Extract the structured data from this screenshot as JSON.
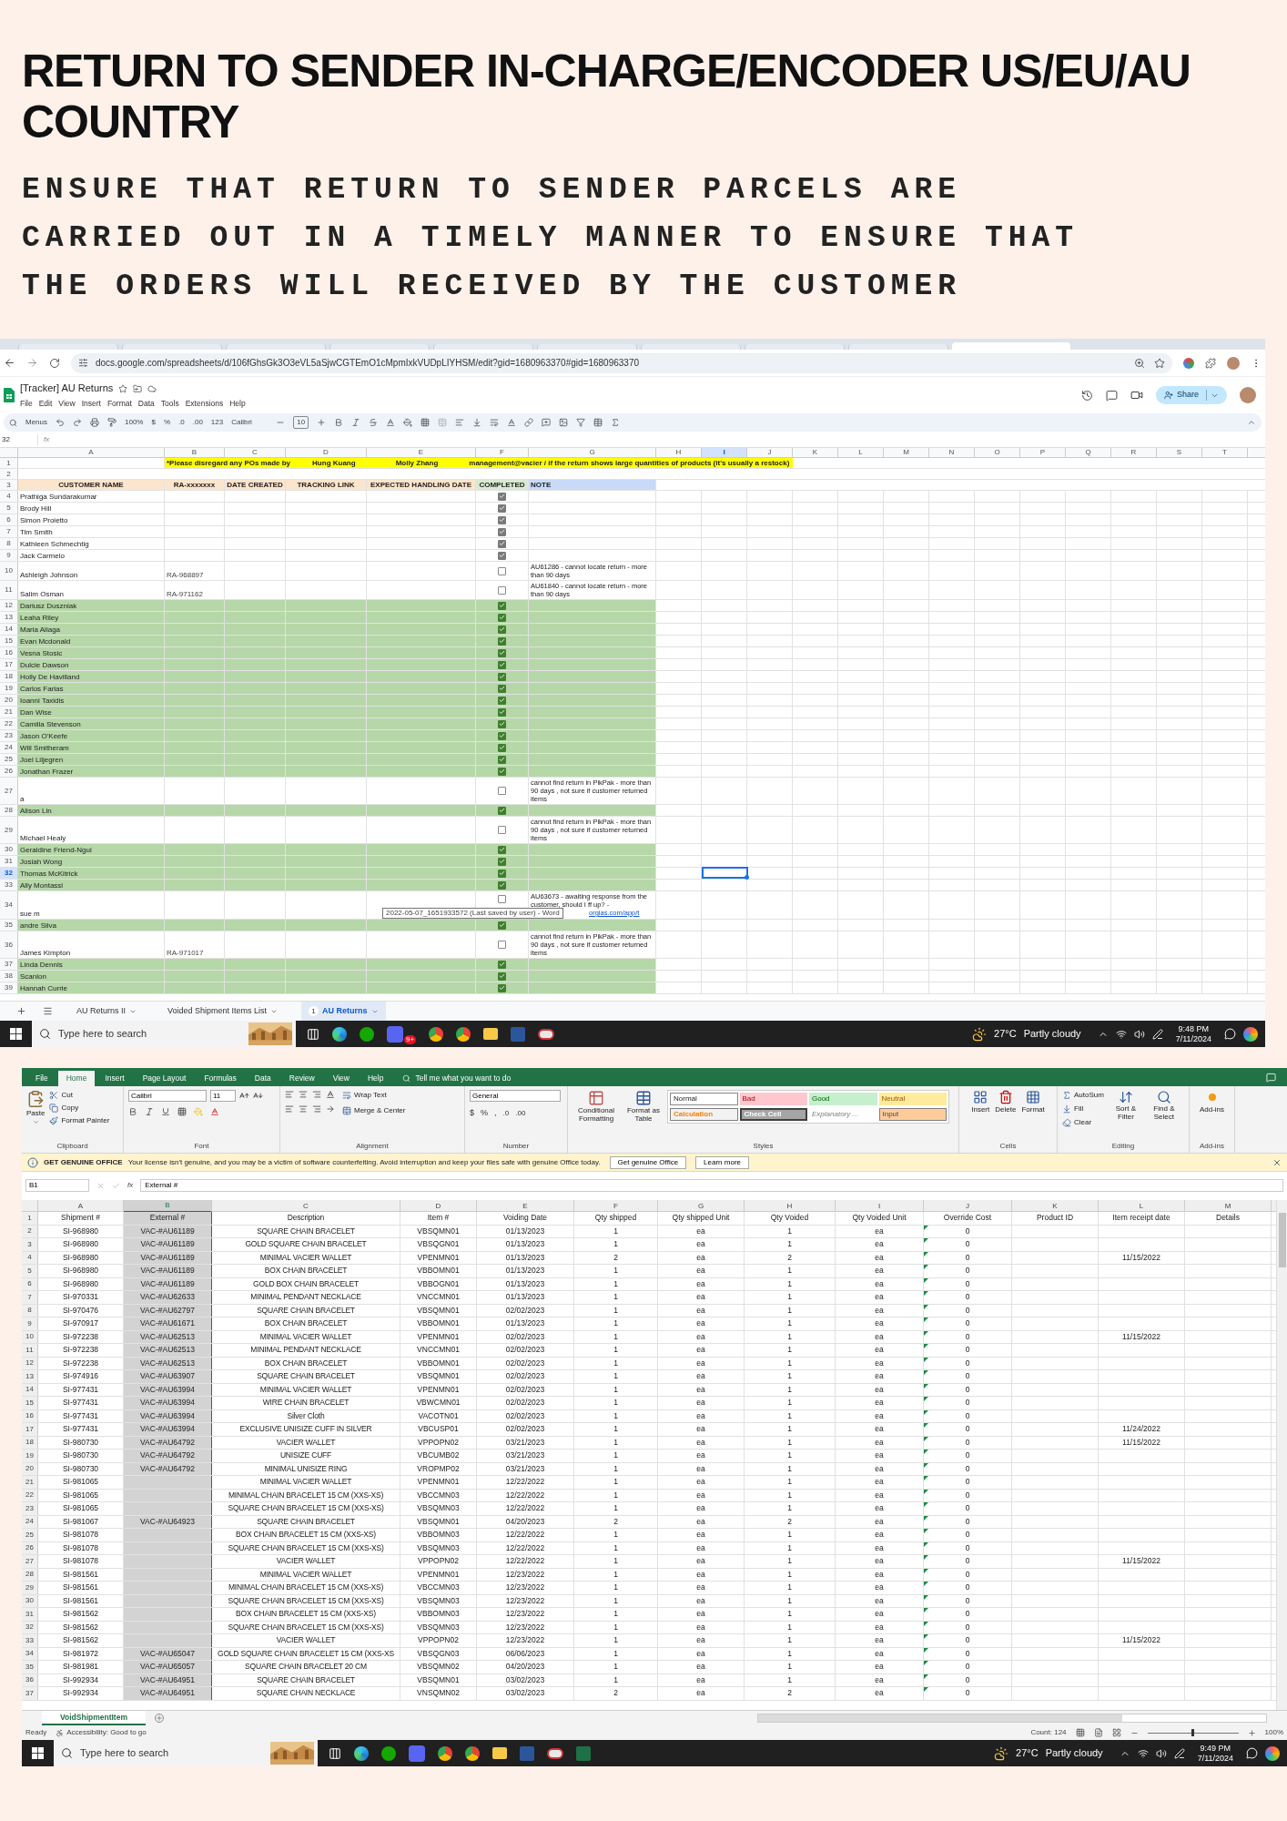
{
  "heading": {
    "title": "RETURN TO SENDER IN-CHARGE/ENCODER US/EU/AU COUNTRY",
    "subtitle": "ENSURE THAT RETURN TO SENDER PARCELS ARE CARRIED OUT IN A TIMELY MANNER TO ENSURE THAT THE ORDERS WILL RECEIVED BY THE CUSTOMER"
  },
  "sheets": {
    "url": "docs.google.com/spreadsheets/d/106fGhsGk3O3eVL5aSjwCGTEmO1cMpmIxkVUDpLIYHSM/edit?gid=1680963370#gid=1680963370",
    "title": "[Tracker] AU Returns",
    "menu": [
      "File",
      "Edit",
      "View",
      "Insert",
      "Format",
      "Data",
      "Tools",
      "Extensions",
      "Help"
    ],
    "share": "Share",
    "toolbar": {
      "menus": "Menus",
      "zoom": "100%",
      "currency": "$",
      "percent": "%",
      "decrease_decimal": ".0",
      "increase_decimal": ".00",
      "number_format": "123",
      "font": "Calibri",
      "font_size": "10"
    },
    "browser_tabs": [
      {
        "selected": false
      },
      {
        "selected": false
      },
      {
        "selected": false
      },
      {
        "selected": false
      },
      {
        "selected": false
      },
      {
        "selected": false
      },
      {
        "selected": false
      },
      {
        "selected": false
      },
      {
        "selected": false
      },
      {
        "selected": true
      }
    ],
    "name_box": "32",
    "formula_icon": "fx",
    "columns": [
      {
        "letter": "A",
        "selected": false
      },
      {
        "letter": "B",
        "selected": false
      },
      {
        "letter": "C",
        "selected": false
      },
      {
        "letter": "D",
        "selected": false
      },
      {
        "letter": "E",
        "selected": false
      },
      {
        "letter": "F",
        "selected": false
      },
      {
        "letter": "G",
        "selected": false
      },
      {
        "letter": "H",
        "selected": false
      },
      {
        "letter": "I",
        "selected": true
      },
      {
        "letter": "J",
        "selected": false
      },
      {
        "letter": "K",
        "selected": false
      },
      {
        "letter": "L",
        "selected": false
      },
      {
        "letter": "M",
        "selected": false
      },
      {
        "letter": "N",
        "selected": false
      },
      {
        "letter": "O",
        "selected": false
      },
      {
        "letter": "P",
        "selected": false
      },
      {
        "letter": "Q",
        "selected": false
      },
      {
        "letter": "R",
        "selected": false
      },
      {
        "letter": "S",
        "selected": false
      },
      {
        "letter": "T",
        "selected": false
      }
    ],
    "notice": [
      "*Please disregard any POs made by",
      "Hung Kuang",
      "Molly Zhang",
      "management@vacier / if the return shows large quantities of products (it's usually a restock)"
    ],
    "headers": [
      "CUSTOMER NAME",
      "RA-xxxxxxx",
      "DATE CREATED",
      "TRACKING LINK",
      "EXPECTED HANDLING DATE",
      "COMPLETED",
      "NOTE"
    ],
    "top_rows": [
      "1",
      "2",
      "3"
    ],
    "rows": [
      {
        "row": "4",
        "name": "Prathiga Sundarakumar",
        "completed": true,
        "highlighted": false,
        "active": false
      },
      {
        "row": "5",
        "name": "Brody Hill",
        "completed": true,
        "highlighted": false,
        "active": false
      },
      {
        "row": "6",
        "name": "Simon Proietto",
        "completed": true,
        "highlighted": false,
        "active": false
      },
      {
        "row": "7",
        "name": "Tim Smith",
        "completed": true,
        "highlighted": false,
        "active": false
      },
      {
        "row": "8",
        "name": "Kathleen Schmechtig",
        "completed": true,
        "highlighted": false,
        "active": false
      },
      {
        "row": "9",
        "name": "Jack Carmelo",
        "completed": true,
        "highlighted": false,
        "active": false
      },
      {
        "row": "10",
        "name": "Ashleigh Johnson",
        "ra": "RA-968897",
        "completed": false,
        "highlighted": false,
        "active": false,
        "note": "AU61286 - cannot locate return - more than 90 days"
      },
      {
        "row": "11",
        "name": "Salim Osman",
        "ra": "RA-971162",
        "completed": false,
        "highlighted": false,
        "active": false,
        "note": "AU61840 - cannot locate return - more than 90 days"
      },
      {
        "row": "12",
        "name": "Dariusz Duszniak",
        "completed": true,
        "highlighted": true,
        "active": false
      },
      {
        "row": "13",
        "name": "Leaha Riley",
        "completed": true,
        "highlighted": true,
        "active": false
      },
      {
        "row": "14",
        "name": "Maria Aliaga",
        "completed": true,
        "highlighted": true,
        "active": false
      },
      {
        "row": "15",
        "name": "Evan Mcdonald",
        "completed": true,
        "highlighted": true,
        "active": false
      },
      {
        "row": "16",
        "name": "Vesna Stosic",
        "completed": true,
        "highlighted": true,
        "active": false
      },
      {
        "row": "17",
        "name": "Dulcie Dawson",
        "completed": true,
        "highlighted": true,
        "active": false
      },
      {
        "row": "18",
        "name": "Holly De Havilland",
        "completed": true,
        "highlighted": true,
        "active": false
      },
      {
        "row": "19",
        "name": "Carlos Farias",
        "completed": true,
        "highlighted": true,
        "active": false
      },
      {
        "row": "20",
        "name": "Ioanni Taxidis",
        "completed": true,
        "highlighted": true,
        "active": false
      },
      {
        "row": "21",
        "name": "Dan Wise",
        "completed": true,
        "highlighted": true,
        "active": false
      },
      {
        "row": "22",
        "name": "Camilla Stevenson",
        "completed": true,
        "highlighted": true,
        "active": false
      },
      {
        "row": "23",
        "name": "Jason O'Keefe",
        "completed": true,
        "highlighted": true,
        "active": false
      },
      {
        "row": "24",
        "name": "Will Smitheram",
        "completed": true,
        "highlighted": true,
        "active": false
      },
      {
        "row": "25",
        "name": "Joel Liljegren",
        "completed": true,
        "highlighted": true,
        "active": false
      },
      {
        "row": "26",
        "name": "Jonathan Frazer",
        "completed": true,
        "highlighted": true,
        "active": false
      },
      {
        "row": "27",
        "name": "a",
        "completed": false,
        "highlighted": false,
        "active": false,
        "note": "cannot find return in PikPak - more than 90 days , not sure if customer returned items"
      },
      {
        "row": "28",
        "name": "Alison Lin",
        "completed": true,
        "highlighted": true,
        "active": false
      },
      {
        "row": "29",
        "name": "Michael Healy",
        "completed": false,
        "highlighted": false,
        "active": false,
        "note": "cannot find return in PikPak - more than 90 days , not sure if customer returned items"
      },
      {
        "row": "30",
        "name": "Geraldine Friend-Ngui",
        "completed": true,
        "highlighted": true,
        "active": false
      },
      {
        "row": "31",
        "name": "Josiah Wong",
        "completed": true,
        "highlighted": true,
        "active": false
      },
      {
        "row": "32",
        "name": "Thomas McKitrick",
        "completed": true,
        "highlighted": true,
        "active": true
      },
      {
        "row": "33",
        "name": "Ally Montassi",
        "completed": true,
        "highlighted": true,
        "active": false
      },
      {
        "row": "34",
        "name": "sue m",
        "completed": false,
        "highlighted": false,
        "active": false,
        "note": "AU63673 - awaiting response from the customer, should I ff up? -",
        "link": "orgias.com/app/t"
      },
      {
        "row": "35",
        "name": "andre Silva",
        "completed": true,
        "highlighted": true,
        "active": false
      },
      {
        "row": "36",
        "name": "James Kimpton",
        "ra": "RA-971017",
        "completed": false,
        "highlighted": false,
        "active": false,
        "note": "cannot find return in PikPak - more than 90 days , not sure if customer returned items"
      },
      {
        "row": "37",
        "name": "Linda Dennis",
        "completed": true,
        "highlighted": true,
        "active": false
      },
      {
        "row": "38",
        "name": "Scanlon",
        "completed": true,
        "highlighted": true,
        "active": false
      },
      {
        "row": "39",
        "name": "Hannah Currie",
        "completed": true,
        "highlighted": true,
        "active": false
      }
    ],
    "tooltip": "2022-05-07_1651933572 (Last saved by user) - Word",
    "sheet_tabs": [
      {
        "label": "AU Returns II",
        "selected": false
      },
      {
        "label": "Voided Shipment Items List",
        "selected": false
      },
      {
        "label": "AU Returns",
        "selected": true,
        "badge": "1"
      }
    ],
    "taskbar": {
      "search_placeholder": "Type here to search",
      "badge": "9+",
      "temperature": "27°C",
      "weather": "Partly cloudy",
      "time": "9:48 PM",
      "date": "7/11/2024"
    }
  },
  "excel": {
    "ribbon_tabs": [
      {
        "label": "File",
        "selected": false
      },
      {
        "label": "Home",
        "selected": true
      },
      {
        "label": "Insert",
        "selected": false
      },
      {
        "label": "Page Layout",
        "selected": false
      },
      {
        "label": "Formulas",
        "selected": false
      },
      {
        "label": "Data",
        "selected": false
      },
      {
        "label": "Review",
        "selected": false
      },
      {
        "label": "View",
        "selected": false
      },
      {
        "label": "Help",
        "selected": false
      }
    ],
    "tell_me": "Tell me what you want to do",
    "clipboard": {
      "paste": "Paste",
      "cut": "Cut",
      "copy": "Copy",
      "format_painter": "Format Painter"
    },
    "font": {
      "name": "Calibri",
      "size": "11"
    },
    "alignment": {
      "wrap_text": "Wrap Text",
      "merge": "Merge & Center"
    },
    "number": {
      "format": "General",
      "symbols": [
        "$",
        "%",
        ","
      ],
      "decimals": [
        ".0",
        ".00"
      ]
    },
    "styles": {
      "conditional": "Conditional Formatting",
      "format_table": "Format as Table",
      "gallery": [
        {
          "label": "Normal",
          "kind": "normal"
        },
        {
          "label": "Bad",
          "kind": "bad"
        },
        {
          "label": "Good",
          "kind": "good"
        },
        {
          "label": "Neutral",
          "kind": "neutral"
        },
        {
          "label": "Calculation",
          "kind": "calculation"
        },
        {
          "label": "Check Cell",
          "kind": "check"
        },
        {
          "label": "Explanatory ...",
          "kind": "explanatory"
        },
        {
          "label": "Input",
          "kind": "input"
        }
      ]
    },
    "cells": [
      "Insert",
      "Delete",
      "Format"
    ],
    "editing": {
      "autosum": "AutoSum",
      "fill": "Fill",
      "clear": "Clear",
      "sort": "Sort & Filter",
      "find": "Find & Select"
    },
    "addins": "Add-ins",
    "group_labels": [
      "Clipboard",
      "Font",
      "Alignment",
      "Number",
      "Styles",
      "Cells",
      "Editing",
      "Add-ins"
    ],
    "message": {
      "title": "GET GENUINE OFFICE",
      "text": "Your license isn't genuine, and you may be a victim of software counterfeiting. Avoid interruption and keep your files safe with genuine Office today.",
      "buttons": [
        "Get genuine Office",
        "Learn more"
      ]
    },
    "name_box": "B1",
    "formula_icon": "fx",
    "formula": "External #",
    "columns": [
      {
        "letter": "A",
        "selected": false
      },
      {
        "letter": "B",
        "selected": true
      },
      {
        "letter": "C",
        "selected": false
      },
      {
        "letter": "D",
        "selected": false
      },
      {
        "letter": "E",
        "selected": false
      },
      {
        "letter": "F",
        "selected": false
      },
      {
        "letter": "G",
        "selected": false
      },
      {
        "letter": "H",
        "selected": false
      },
      {
        "letter": "I",
        "selected": false
      },
      {
        "letter": "J",
        "selected": false
      },
      {
        "letter": "K",
        "selected": false
      },
      {
        "letter": "L",
        "selected": false
      },
      {
        "letter": "M",
        "selected": false
      }
    ],
    "override_cost_flagged": true,
    "rows": [
      {
        "row": "1",
        "A": "Shipment #",
        "B": "External #",
        "C": "Description",
        "D": "Item #",
        "E": "Voiding Date",
        "F": "Qty shipped",
        "G": "Qty shipped Unit",
        "H": "Qty Voided",
        "I": "Qty Voided Unit",
        "J": "Override Cost",
        "K": "Product ID",
        "L": "Item receipt date",
        "M": "Details"
      },
      {
        "row": "2",
        "A": "SI-968980",
        "B": "VAC-#AU61189",
        "C": "SQUARE CHAIN BRACELET",
        "D": "VBSQMN01",
        "E": "01/13/2023",
        "F": "1",
        "G": "ea",
        "H": "1",
        "I": "ea",
        "J": "0"
      },
      {
        "row": "3",
        "A": "SI-968980",
        "B": "VAC-#AU61189",
        "C": "GOLD SQUARE CHAIN BRACELET",
        "D": "VBSQGN01",
        "E": "01/13/2023",
        "F": "1",
        "G": "ea",
        "H": "1",
        "I": "ea",
        "J": "0"
      },
      {
        "row": "4",
        "A": "SI-968980",
        "B": "VAC-#AU61189",
        "C": "MINIMAL VACIER WALLET",
        "D": "VPENMN01",
        "E": "01/13/2023",
        "F": "2",
        "G": "ea",
        "H": "2",
        "I": "ea",
        "J": "0",
        "L": "11/15/2022"
      },
      {
        "row": "5",
        "A": "SI-968980",
        "B": "VAC-#AU61189",
        "C": "BOX CHAIN BRACELET",
        "D": "VBBOMN01",
        "E": "01/13/2023",
        "F": "1",
        "G": "ea",
        "H": "1",
        "I": "ea",
        "J": "0"
      },
      {
        "row": "6",
        "A": "SI-968980",
        "B": "VAC-#AU61189",
        "C": "GOLD BOX CHAIN BRACELET",
        "D": "VBBOGN01",
        "E": "01/13/2023",
        "F": "1",
        "G": "ea",
        "H": "1",
        "I": "ea",
        "J": "0"
      },
      {
        "row": "7",
        "A": "SI-970331",
        "B": "VAC-#AU62633",
        "C": "MINIMAL PENDANT NECKLACE",
        "D": "VNCCMN01",
        "E": "01/13/2023",
        "F": "1",
        "G": "ea",
        "H": "1",
        "I": "ea",
        "J": "0"
      },
      {
        "row": "8",
        "A": "SI-970476",
        "B": "VAC-#AU62797",
        "C": "SQUARE CHAIN BRACELET",
        "D": "VBSQMN01",
        "E": "02/02/2023",
        "F": "1",
        "G": "ea",
        "H": "1",
        "I": "ea",
        "J": "0"
      },
      {
        "row": "9",
        "A": "SI-970917",
        "B": "VAC-#AU61671",
        "C": "BOX CHAIN BRACELET",
        "D": "VBBOMN01",
        "E": "01/13/2023",
        "F": "1",
        "G": "ea",
        "H": "1",
        "I": "ea",
        "J": "0"
      },
      {
        "row": "10",
        "A": "SI-972238",
        "B": "VAC-#AU62513",
        "C": "MINIMAL VACIER WALLET",
        "D": "VPENMN01",
        "E": "02/02/2023",
        "F": "1",
        "G": "ea",
        "H": "1",
        "I": "ea",
        "J": "0",
        "L": "11/15/2022"
      },
      {
        "row": "11",
        "A": "SI-972238",
        "B": "VAC-#AU62513",
        "C": "MINIMAL PENDANT NECKLACE",
        "D": "VNCCMN01",
        "E": "02/02/2023",
        "F": "1",
        "G": "ea",
        "H": "1",
        "I": "ea",
        "J": "0"
      },
      {
        "row": "12",
        "A": "SI-972238",
        "B": "VAC-#AU62513",
        "C": "BOX CHAIN BRACELET",
        "D": "VBBOMN01",
        "E": "02/02/2023",
        "F": "1",
        "G": "ea",
        "H": "1",
        "I": "ea",
        "J": "0"
      },
      {
        "row": "13",
        "A": "SI-974916",
        "B": "VAC-#AU63907",
        "C": "SQUARE CHAIN BRACELET",
        "D": "VBSQMN01",
        "E": "02/02/2023",
        "F": "1",
        "G": "ea",
        "H": "1",
        "I": "ea",
        "J": "0"
      },
      {
        "row": "14",
        "A": "SI-977431",
        "B": "VAC-#AU63994",
        "C": "MINIMAL VACIER WALLET",
        "D": "VPENMN01",
        "E": "02/02/2023",
        "F": "1",
        "G": "ea",
        "H": "1",
        "I": "ea",
        "J": "0"
      },
      {
        "row": "15",
        "A": "SI-977431",
        "B": "VAC-#AU63994",
        "C": "WIRE CHAIN BRACELET",
        "D": "VBWCMN01",
        "E": "02/02/2023",
        "F": "1",
        "G": "ea",
        "H": "1",
        "I": "ea",
        "J": "0"
      },
      {
        "row": "16",
        "A": "SI-977431",
        "B": "VAC-#AU63994",
        "C": "Silver Cloth",
        "D": "VACOTN01",
        "E": "02/02/2023",
        "F": "1",
        "G": "ea",
        "H": "1",
        "I": "ea",
        "J": "0"
      },
      {
        "row": "17",
        "A": "SI-977431",
        "B": "VAC-#AU63994",
        "C": "EXCLUSIVE UNISIZE CUFF IN SILVER",
        "D": "VBCUSP01",
        "E": "02/02/2023",
        "F": "1",
        "G": "ea",
        "H": "1",
        "I": "ea",
        "J": "0",
        "L": "11/24/2022"
      },
      {
        "row": "18",
        "A": "SI-980730",
        "B": "VAC-#AU64792",
        "C": "VACIER WALLET",
        "D": "VPPOPN02",
        "E": "03/21/2023",
        "F": "1",
        "G": "ea",
        "H": "1",
        "I": "ea",
        "J": "0",
        "L": "11/15/2022"
      },
      {
        "row": "19",
        "A": "SI-980730",
        "B": "VAC-#AU64792",
        "C": "UNISIZE CUFF",
        "D": "VBCUMB02",
        "E": "03/21/2023",
        "F": "1",
        "G": "ea",
        "H": "1",
        "I": "ea",
        "J": "0"
      },
      {
        "row": "20",
        "A": "SI-980730",
        "B": "VAC-#AU64792",
        "C": "MINIMAL UNISIZE RING",
        "D": "VROPMP02",
        "E": "03/21/2023",
        "F": "1",
        "G": "ea",
        "H": "1",
        "I": "ea",
        "J": "0"
      },
      {
        "row": "21",
        "A": "SI-981065",
        "C": "MINIMAL VACIER WALLET",
        "D": "VPENMN01",
        "E": "12/22/2022",
        "F": "1",
        "G": "ea",
        "H": "1",
        "I": "ea",
        "J": "0"
      },
      {
        "row": "22",
        "A": "SI-981065",
        "C": "MINIMAL CHAIN BRACELET 15 CM (XXS-XS)",
        "D": "VBCCMN03",
        "E": "12/22/2022",
        "F": "1",
        "G": "ea",
        "H": "1",
        "I": "ea",
        "J": "0"
      },
      {
        "row": "23",
        "A": "SI-981065",
        "C": "SQUARE CHAIN BRACELET 15 CM (XXS-XS)",
        "D": "VBSQMN03",
        "E": "12/22/2022",
        "F": "1",
        "G": "ea",
        "H": "1",
        "I": "ea",
        "J": "0"
      },
      {
        "row": "24",
        "A": "SI-981067",
        "B": "VAC-#AU64923",
        "C": "SQUARE CHAIN BRACELET",
        "D": "VBSQMN01",
        "E": "04/20/2023",
        "F": "2",
        "G": "ea",
        "H": "2",
        "I": "ea",
        "J": "0"
      },
      {
        "row": "25",
        "A": "SI-981078",
        "C": "BOX CHAIN BRACELET 15 CM (XXS-XS)",
        "D": "VBBOMN03",
        "E": "12/22/2022",
        "F": "1",
        "G": "ea",
        "H": "1",
        "I": "ea",
        "J": "0"
      },
      {
        "row": "26",
        "A": "SI-981078",
        "C": "SQUARE CHAIN BRACELET 15 CM (XXS-XS)",
        "D": "VBSQMN03",
        "E": "12/22/2022",
        "F": "1",
        "G": "ea",
        "H": "1",
        "I": "ea",
        "J": "0"
      },
      {
        "row": "27",
        "A": "SI-981078",
        "C": "VACIER WALLET",
        "D": "VPPOPN02",
        "E": "12/22/2022",
        "F": "1",
        "G": "ea",
        "H": "1",
        "I": "ea",
        "J": "0",
        "L": "11/15/2022"
      },
      {
        "row": "28",
        "A": "SI-981561",
        "C": "MINIMAL VACIER WALLET",
        "D": "VPENMN01",
        "E": "12/23/2022",
        "F": "1",
        "G": "ea",
        "H": "1",
        "I": "ea",
        "J": "0"
      },
      {
        "row": "29",
        "A": "SI-981561",
        "C": "MINIMAL CHAIN BRACELET 15 CM (XXS-XS)",
        "D": "VBCCMN03",
        "E": "12/23/2022",
        "F": "1",
        "G": "ea",
        "H": "1",
        "I": "ea",
        "J": "0"
      },
      {
        "row": "30",
        "A": "SI-981561",
        "C": "SQUARE CHAIN BRACELET 15 CM (XXS-XS)",
        "D": "VBSQMN03",
        "E": "12/23/2022",
        "F": "1",
        "G": "ea",
        "H": "1",
        "I": "ea",
        "J": "0"
      },
      {
        "row": "31",
        "A": "SI-981562",
        "C": "BOX CHAIN BRACELET 15 CM (XXS-XS)",
        "D": "VBBOMN03",
        "E": "12/23/2022",
        "F": "1",
        "G": "ea",
        "H": "1",
        "I": "ea",
        "J": "0"
      },
      {
        "row": "32",
        "A": "SI-981562",
        "C": "SQUARE CHAIN BRACELET 15 CM (XXS-XS)",
        "D": "VBSQMN03",
        "E": "12/23/2022",
        "F": "1",
        "G": "ea",
        "H": "1",
        "I": "ea",
        "J": "0"
      },
      {
        "row": "33",
        "A": "SI-981562",
        "C": "VACIER WALLET",
        "D": "VPPOPN02",
        "E": "12/23/2022",
        "F": "1",
        "G": "ea",
        "H": "1",
        "I": "ea",
        "J": "0",
        "L": "11/15/2022"
      },
      {
        "row": "34",
        "A": "SI-981972",
        "B": "VAC-#AU65047",
        "C": "GOLD SQUARE CHAIN BRACELET 15 CM (XXS-XS",
        "D": "VBSQGN03",
        "E": "06/06/2023",
        "F": "1",
        "G": "ea",
        "H": "1",
        "I": "ea",
        "J": "0"
      },
      {
        "row": "35",
        "A": "SI-981981",
        "B": "VAC-#AU65057",
        "C": "SQUARE CHAIN BRACELET 20 CM",
        "D": "VBSQMN02",
        "E": "04/20/2023",
        "F": "1",
        "G": "ea",
        "H": "1",
        "I": "ea",
        "J": "0"
      },
      {
        "row": "36",
        "A": "SI-992934",
        "B": "VAC-#AU64951",
        "C": "SQUARE CHAIN BRACELET",
        "D": "VBSQMN01",
        "E": "03/02/2023",
        "F": "1",
        "G": "ea",
        "H": "1",
        "I": "ea",
        "J": "0"
      },
      {
        "row": "37",
        "A": "SI-992934",
        "B": "VAC-#AU64951",
        "C": "SQUARE CHAIN NECKLACE",
        "D": "VNSQMN02",
        "E": "03/02/2023",
        "F": "2",
        "G": "ea",
        "H": "2",
        "I": "ea",
        "J": "0"
      }
    ],
    "sheet_tab": "VoidShipmentItem",
    "status": {
      "ready": "Ready",
      "accessibility": "Accessibility: Good to go",
      "count": "Count: 124",
      "zoom": "100%"
    },
    "zoom_slider": {
      "level": 0.5
    },
    "taskbar": {
      "search_placeholder": "Type here to search",
      "temperature": "27°C",
      "weather": "Partly cloudy",
      "time": "9:49 PM",
      "date": "7/11/2024"
    }
  }
}
